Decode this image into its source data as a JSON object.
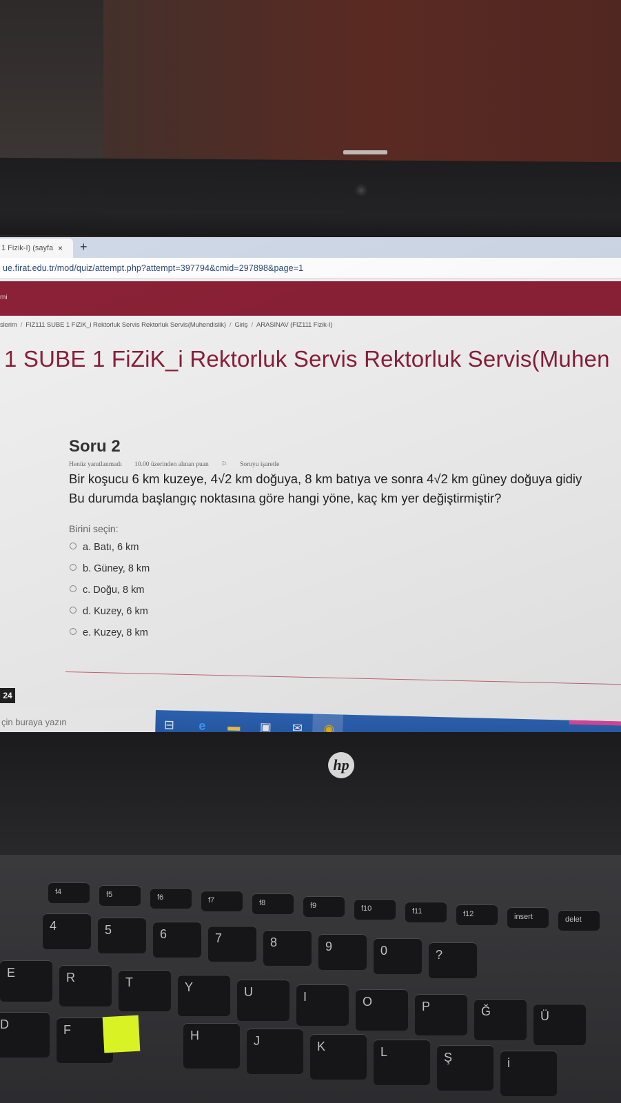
{
  "browser": {
    "tab_title": "1 Fizik-I) (sayfa",
    "tab_close": "×",
    "new_tab": "+",
    "url": "ue.firat.edu.tr/mod/quiz/attempt.php?attempt=397794&cmid=297898&page=1"
  },
  "site": {
    "header_text": "mi"
  },
  "breadcrumb": [
    "slerim",
    "FIZ111 SUBE 1 FiZiK_i Rektorluk Servis Rektorluk Servis(Muhendislik)",
    "Giriş",
    "ARASINAV (FIZ111 Fizik-I)"
  ],
  "course_title": "1 SUBE 1 FiZiK_i Rektorluk Servis Rektorluk Servis(Muhen",
  "question": {
    "number": "Soru 2",
    "status": "Henüz yanıtlanmadı",
    "points": "10.00 üzerinden alınan puan",
    "flag": "Soruyu işaretle",
    "text_line1": "Bir koşucu 6 km kuzeye, 4√2 km doğuya, 8 km batıya ve sonra 4√2 km güney doğuya gidiy",
    "text_line2": "Bu durumda başlangıç noktasına göre hangi yöne, kaç km yer değiştirmiştir?",
    "choose_label": "Birini seçin:",
    "options": [
      "a. Batı, 6 km",
      "b. Güney, 8 km",
      "c. Doğu, 8 km",
      "d. Kuzey, 6 km",
      "e. Kuzey, 8 km"
    ]
  },
  "taskbar": {
    "clock_fragment": "24",
    "search_placeholder": "çin buraya yazın"
  },
  "keyboard": {
    "row_fn": [
      "f4",
      "f5",
      "f6",
      "f7",
      "f8",
      "f9",
      "f10",
      "f11",
      "f12",
      "insert",
      "delet"
    ],
    "row_num": [
      "4",
      "5",
      "6",
      "7",
      "8",
      "9",
      "0",
      "?"
    ],
    "row_top": [
      "E",
      "R",
      "T",
      "Y",
      "U",
      "I",
      "O",
      "P",
      "Ğ",
      "Ü"
    ],
    "row_home": [
      "D",
      "F",
      "H",
      "J",
      "K",
      "L",
      "Ş",
      "i"
    ]
  },
  "logo": "hp"
}
